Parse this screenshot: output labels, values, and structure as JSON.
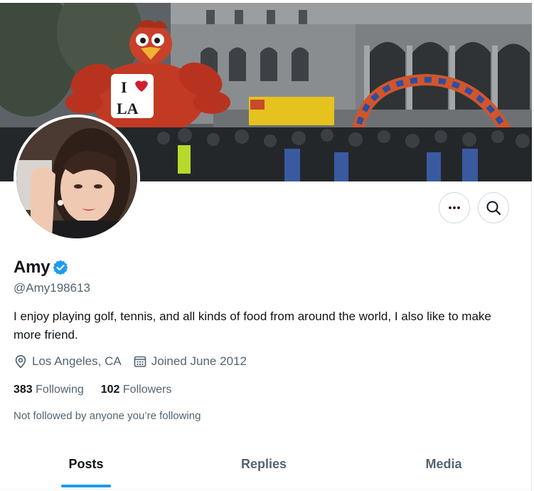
{
  "profile": {
    "name": "Amy",
    "handle": "@Amy198613",
    "bio": "I enjoy playing golf, tennis, and all kinds of food from around the world, I also like to make more friend.",
    "location": "Los Angeles, CA",
    "joined": "Joined June 2012",
    "verified": true
  },
  "banner": {
    "balloon_text_top": "I",
    "balloon_text_bottom": "LA"
  },
  "stats": {
    "following_count": "383",
    "following_label": "Following",
    "followers_count": "102",
    "followers_label": "Followers"
  },
  "social_context": "Not followed by anyone you’re following",
  "tabs": {
    "posts": "Posts",
    "replies": "Replies",
    "media": "Media",
    "active": "Posts"
  },
  "icons": {
    "more": "ellipsis-icon",
    "search": "search-icon",
    "location": "location-pin-icon",
    "joined": "calendar-icon",
    "verified": "verified-badge-icon"
  },
  "colors": {
    "accent": "#1d9bf0",
    "text_primary": "#0f1419",
    "text_secondary": "#536471"
  }
}
